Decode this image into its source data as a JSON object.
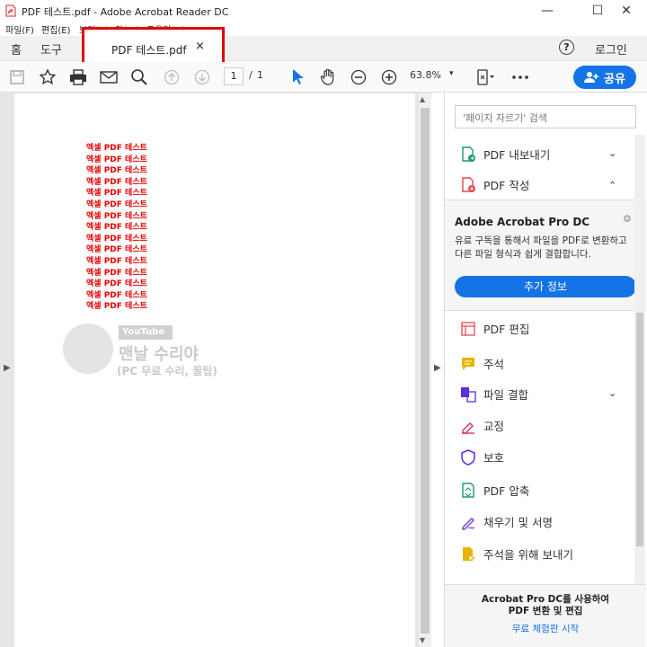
{
  "window": {
    "title": "PDF 테스트.pdf - Adobe Acrobat Reader DC",
    "min": "—",
    "max": "☐",
    "close": "✕"
  },
  "menu": [
    "파일(F)",
    "편집(E)",
    "보기(V)",
    "창(W)",
    "도움말(H)"
  ],
  "tabs": {
    "home": "홈",
    "tools": "도구",
    "doc": "PDF 테스트.pdf",
    "doc_close": "×",
    "help": "?",
    "login": "로그인"
  },
  "toolbar": {
    "page_current": "1",
    "page_sep": "/",
    "page_total": "1",
    "zoom": "63.8%",
    "zoom_caret": "▾",
    "share": "공유"
  },
  "document": {
    "lines": [
      "엑셀 PDF 테스트",
      "엑셀 PDF 테스트",
      "엑셀 PDF 테스트",
      "엑셀 PDF 테스트",
      "엑셀 PDF 테스트",
      "엑셀 PDF 테스트",
      "엑셀 PDF 테스트",
      "엑셀 PDF 테스트",
      "엑셀 PDF 테스트",
      "엑셀 PDF 테스트",
      "엑셀 PDF 테스트",
      "엑셀 PDF 테스트",
      "엑셀 PDF 테스트",
      "엑셀 PDF 테스트",
      "엑셀 PDF 테스트"
    ],
    "watermark_badge": "YouTube",
    "watermark_title": "맨날 수리야",
    "watermark_sub": "(PC 무료 수리, 꿀팁)"
  },
  "rightpane": {
    "search_placeholder": "'페이지 자르기' 검색",
    "items": [
      {
        "label": "PDF 내보내기",
        "icon": "export-pdf-icon",
        "color": "#1a9b6c",
        "chevron": "⌄"
      },
      {
        "label": "PDF 작성",
        "icon": "create-pdf-icon",
        "color": "#e34850",
        "chevron": "⌃"
      }
    ],
    "promo": {
      "title": "Adobe Acrobat Pro DC",
      "desc": "유료 구독을 통해서 파일을 PDF로 변환하고 다른 파일 형식과 쉽게 결합합니다.",
      "button": "추가 정보"
    },
    "tools": [
      {
        "label": "PDF 편집",
        "icon": "edit-pdf-icon",
        "color": "#e34850"
      },
      {
        "label": "주석",
        "icon": "comment-icon",
        "color": "#e8b400"
      },
      {
        "label": "파일 결합",
        "icon": "combine-files-icon",
        "color": "#5c2ee0",
        "chevron": "⌄"
      },
      {
        "label": "교정",
        "icon": "redact-icon",
        "color": "#d6336c"
      },
      {
        "label": "보호",
        "icon": "protect-icon",
        "color": "#5c2ee0"
      },
      {
        "label": "PDF 압축",
        "icon": "compress-pdf-icon",
        "color": "#1a9b6c"
      },
      {
        "label": "채우기 및 서명",
        "icon": "fill-sign-icon",
        "color": "#7b3fe4"
      },
      {
        "label": "주석을 위해 보내기",
        "icon": "send-for-comments-icon",
        "color": "#e8b400"
      }
    ],
    "footer": {
      "line1": "Acrobat Pro DC를 사용하여",
      "line2": "PDF 변환 및 편집",
      "link": "무료 체험판 시작"
    }
  },
  "colors": {
    "accent": "#1473e6",
    "highlight": "#e60000"
  }
}
